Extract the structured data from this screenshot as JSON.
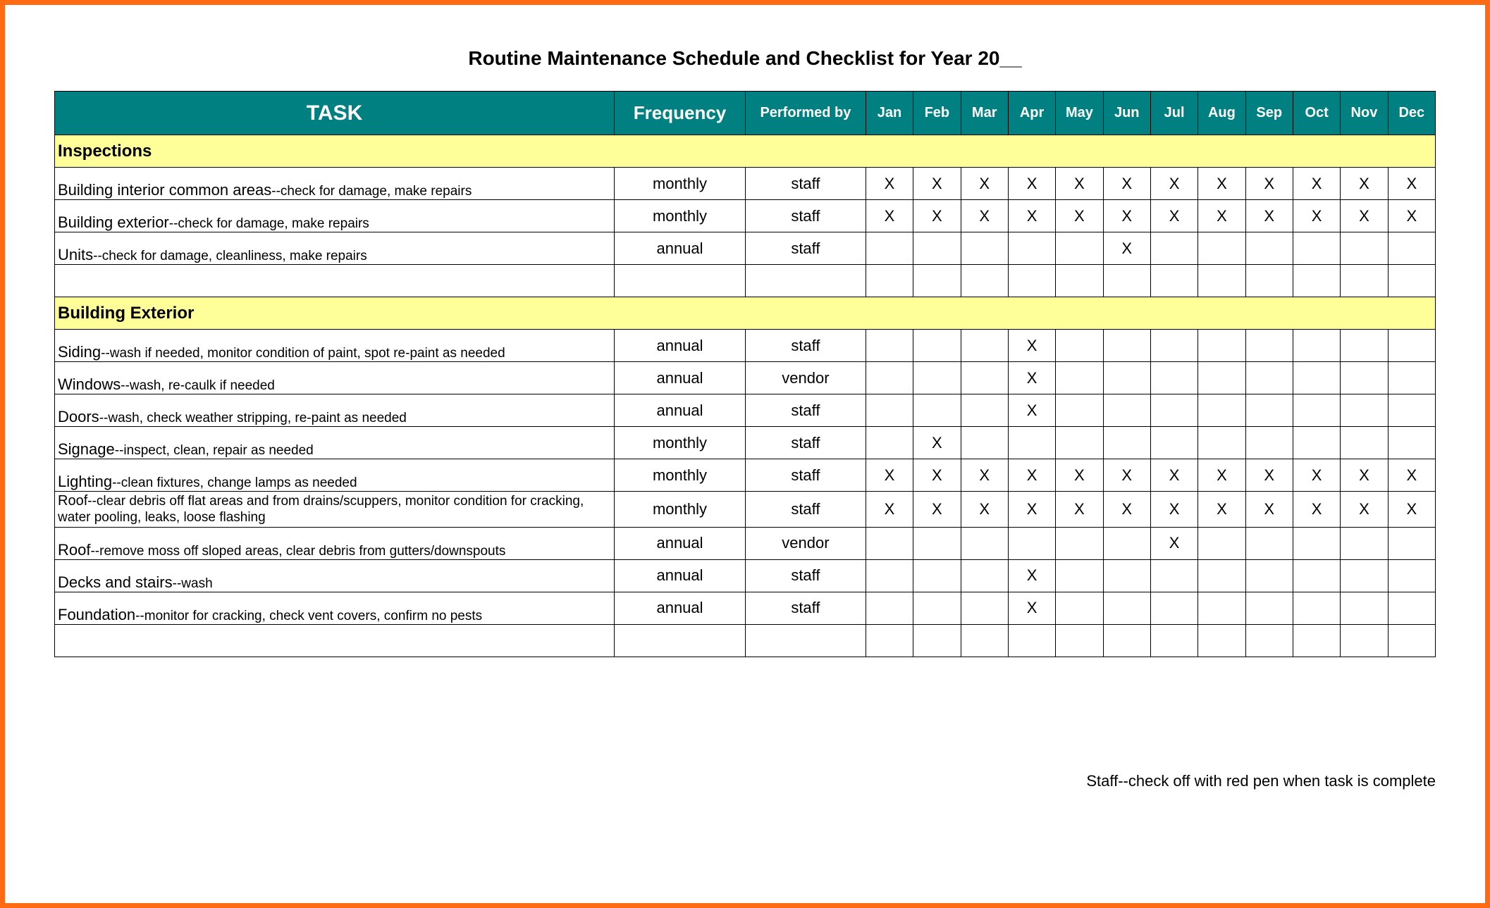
{
  "title": "Routine Maintenance Schedule and Checklist for Year 20__",
  "headers": {
    "task": "TASK",
    "frequency": "Frequency",
    "performed": "Performed by",
    "months": [
      "Jan",
      "Feb",
      "Mar",
      "Apr",
      "May",
      "Jun",
      "Jul",
      "Aug",
      "Sep",
      "Oct",
      "Nov",
      "Dec"
    ]
  },
  "sections": [
    {
      "name": "Inspections",
      "rows": [
        {
          "task_bold": "Building interior common areas",
          "task_rest": "--check for damage, make repairs",
          "frequency": "monthly",
          "performed": "staff",
          "months": [
            "X",
            "X",
            "X",
            "X",
            "X",
            "X",
            "X",
            "X",
            "X",
            "X",
            "X",
            "X"
          ]
        },
        {
          "task_bold": "Building exterior",
          "task_rest": "--check for damage, make repairs",
          "frequency": "monthly",
          "performed": "staff",
          "months": [
            "X",
            "X",
            "X",
            "X",
            "X",
            "X",
            "X",
            "X",
            "X",
            "X",
            "X",
            "X"
          ]
        },
        {
          "task_bold": "Units",
          "task_rest": "--check for damage, cleanliness, make repairs",
          "frequency": "annual",
          "performed": "staff",
          "months": [
            "",
            "",
            "",
            "",
            "",
            "X",
            "",
            "",
            "",
            "",
            "",
            ""
          ]
        },
        {
          "blank": true
        }
      ]
    },
    {
      "name": "Building Exterior",
      "rows": [
        {
          "task_bold": "Siding",
          "task_rest": "--wash if needed, monitor condition of paint, spot re-paint as needed",
          "frequency": "annual",
          "performed": "staff",
          "months": [
            "",
            "",
            "",
            "X",
            "",
            "",
            "",
            "",
            "",
            "",
            "",
            ""
          ]
        },
        {
          "task_bold": "Windows",
          "task_rest": "--wash, re-caulk if needed",
          "frequency": "annual",
          "performed": "vendor",
          "months": [
            "",
            "",
            "",
            "X",
            "",
            "",
            "",
            "",
            "",
            "",
            "",
            ""
          ]
        },
        {
          "task_bold": "Doors",
          "task_rest": "--wash, check weather stripping, re-paint as needed",
          "frequency": "annual",
          "performed": "staff",
          "months": [
            "",
            "",
            "",
            "X",
            "",
            "",
            "",
            "",
            "",
            "",
            "",
            ""
          ]
        },
        {
          "task_bold": "Signage",
          "task_rest": "--inspect, clean, repair as needed",
          "frequency": "monthly",
          "performed": "staff",
          "months": [
            "",
            "X",
            "",
            "",
            "",
            "",
            "",
            "",
            "",
            "",
            "",
            ""
          ]
        },
        {
          "task_bold": "Lighting",
          "task_rest": "--clean fixtures, change lamps as needed",
          "frequency": "monthly",
          "performed": "staff",
          "months": [
            "X",
            "X",
            "X",
            "X",
            "X",
            "X",
            "X",
            "X",
            "X",
            "X",
            "X",
            "X"
          ]
        },
        {
          "task_bold": "Roof",
          "task_rest": "--clear debris off flat areas and from drains/scuppers, monitor condition for cracking, water pooling, leaks, loose flashing",
          "frequency": "monthly",
          "performed": "staff",
          "months": [
            "X",
            "X",
            "X",
            "X",
            "X",
            "X",
            "X",
            "X",
            "X",
            "X",
            "X",
            "X"
          ],
          "multiline": true
        },
        {
          "task_bold": "Roof",
          "task_rest": "--remove moss off sloped areas, clear debris from gutters/downspouts",
          "frequency": "annual",
          "performed": "vendor",
          "months": [
            "",
            "",
            "",
            "",
            "",
            "",
            "X",
            "",
            "",
            "",
            "",
            ""
          ]
        },
        {
          "task_bold": "Decks and stairs",
          "task_rest": "--wash",
          "frequency": "annual",
          "performed": "staff",
          "months": [
            "",
            "",
            "",
            "X",
            "",
            "",
            "",
            "",
            "",
            "",
            "",
            ""
          ]
        },
        {
          "task_bold": "Foundation",
          "task_rest": "--monitor for cracking, check vent covers, confirm no pests",
          "frequency": "annual",
          "performed": "staff",
          "months": [
            "",
            "",
            "",
            "X",
            "",
            "",
            "",
            "",
            "",
            "",
            "",
            ""
          ]
        },
        {
          "blank": true
        }
      ]
    }
  ],
  "footer": "Staff--check off with red pen when task is complete"
}
